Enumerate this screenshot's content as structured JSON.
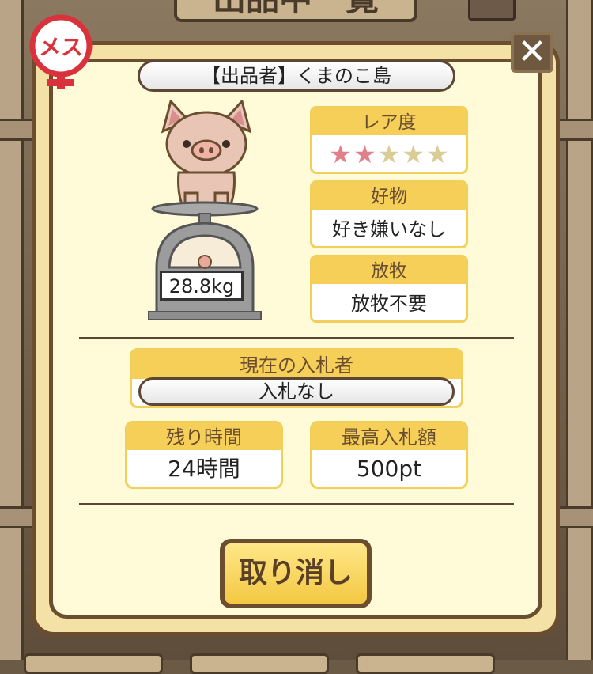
{
  "background": {
    "title": "出品中一覧"
  },
  "badge": {
    "gender_label": "メス"
  },
  "close": {
    "label": "✕"
  },
  "seller": {
    "text": "【出品者】くまのこ島"
  },
  "pig": {
    "weight": "28.8kg"
  },
  "rarity": {
    "label": "レア度",
    "stars_total": 5,
    "stars_filled": 2
  },
  "favorite_food": {
    "label": "好物",
    "value": "好き嫌いなし"
  },
  "grazing": {
    "label": "放牧",
    "value": "放牧不要"
  },
  "bidder": {
    "label": "現在の入札者",
    "value": "入札なし"
  },
  "remaining": {
    "label": "残り時間",
    "value": "24時間"
  },
  "highest_bid": {
    "label": "最高入札額",
    "value": "500pt"
  },
  "cancel": {
    "label": "取り消し"
  },
  "colors": {
    "header_yellow": "#f5cf57",
    "frame_brown": "#6b4e2f",
    "panel_cream": "#fffbd8",
    "badge_red": "#d9323c"
  }
}
